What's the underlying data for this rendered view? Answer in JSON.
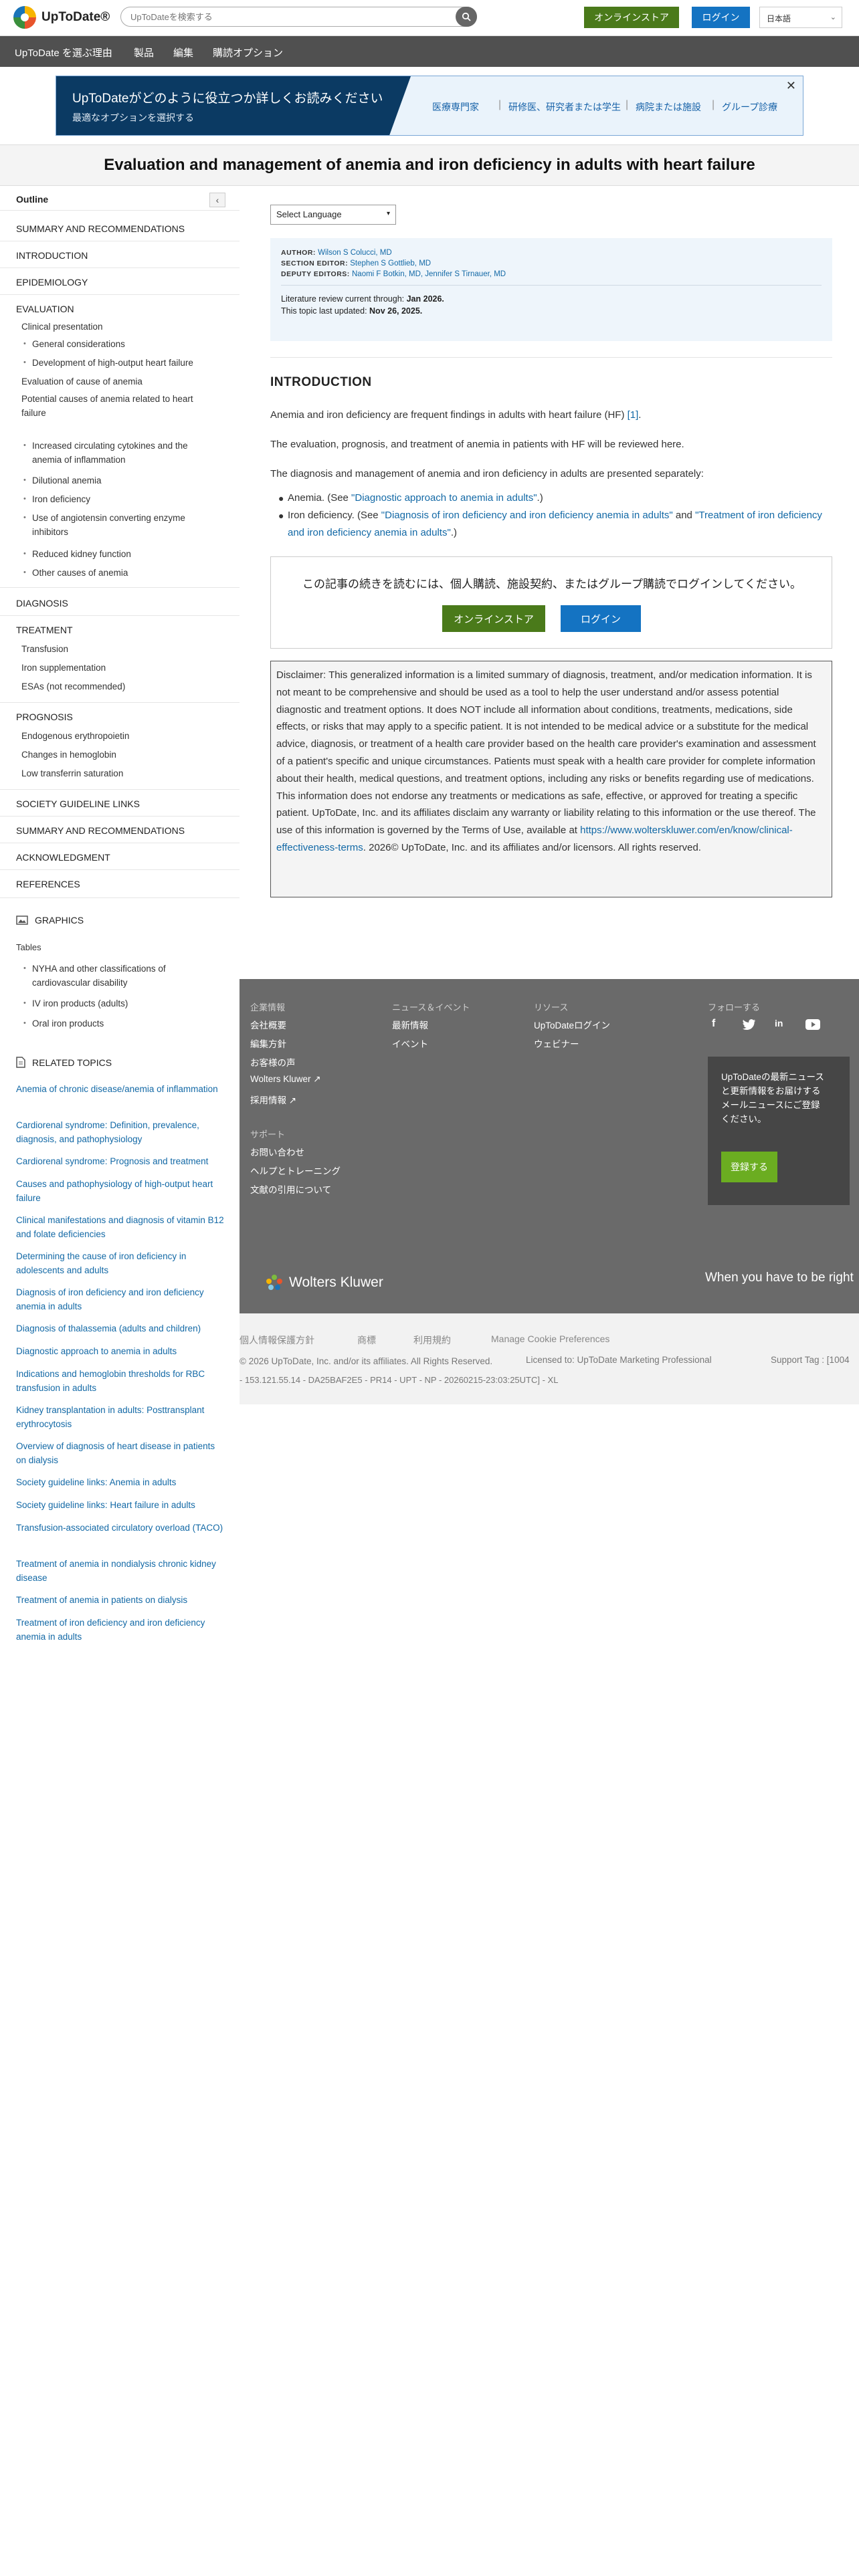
{
  "header": {
    "logo_text": "UpToDate®",
    "search_placeholder": "UpToDateを検索する",
    "store_button": "オンラインストア",
    "login_button": "ログイン",
    "language": "日本語"
  },
  "nav": [
    "UpToDate を選ぶ理由",
    "製品",
    "編集",
    "購読オプション"
  ],
  "banner": {
    "title": "UpToDateがどのように役立つか詳しくお読みください",
    "subtitle": "最適なオプションを選択する",
    "options": [
      "医療専門家",
      "研修医、研究者または学生",
      "病院または施設",
      "グループ診療"
    ]
  },
  "page_title": "Evaluation and management of anemia and iron deficiency in adults with heart failure",
  "outline": {
    "heading": "Outline",
    "items": [
      {
        "text": "SUMMARY AND RECOMMENDATIONS",
        "level": 1
      },
      {
        "text": "INTRODUCTION",
        "level": 1
      },
      {
        "text": "EPIDEMIOLOGY",
        "level": 1
      },
      {
        "text": "EVALUATION",
        "level": 1
      },
      {
        "text": "Clinical presentation",
        "level": 2
      },
      {
        "text": "General considerations",
        "level": 3
      },
      {
        "text": "Development of high-output heart failure",
        "level": 3
      },
      {
        "text": "Evaluation of cause of anemia",
        "level": 2
      },
      {
        "text": "Potential causes of anemia related to heart failure",
        "level": 2
      },
      {
        "text": "Increased circulating cytokines and the anemia of inflammation",
        "level": 3
      },
      {
        "text": "Dilutional anemia",
        "level": 3
      },
      {
        "text": "Iron deficiency",
        "level": 3
      },
      {
        "text": "Use of angiotensin converting enzyme inhibitors",
        "level": 3
      },
      {
        "text": "Reduced kidney function",
        "level": 3
      },
      {
        "text": "Other causes of anemia",
        "level": 3
      },
      {
        "text": "DIAGNOSIS",
        "level": 1
      },
      {
        "text": "TREATMENT",
        "level": 1
      },
      {
        "text": "Transfusion",
        "level": 2
      },
      {
        "text": "Iron supplementation",
        "level": 2
      },
      {
        "text": "ESAs (not recommended)",
        "level": 2
      },
      {
        "text": "PROGNOSIS",
        "level": 1
      },
      {
        "text": "Endogenous erythropoietin",
        "level": 2
      },
      {
        "text": "Changes in hemoglobin",
        "level": 2
      },
      {
        "text": "Low transferrin saturation",
        "level": 2
      },
      {
        "text": "SOCIETY GUIDELINE LINKS",
        "level": 1
      },
      {
        "text": "SUMMARY AND RECOMMENDATIONS",
        "level": 1
      },
      {
        "text": "ACKNOWLEDGMENT",
        "level": 1
      },
      {
        "text": "REFERENCES",
        "level": 1
      }
    ]
  },
  "graphics": {
    "heading": "GRAPHICS",
    "sub": "Tables",
    "items": [
      "NYHA and other classifications of cardiovascular disability",
      "IV iron products (adults)",
      "Oral iron products"
    ]
  },
  "related": {
    "heading": "RELATED TOPICS",
    "items": [
      "Anemia of chronic disease/anemia of inflammation",
      "Cardiorenal syndrome: Definition, prevalence, diagnosis, and pathophysiology",
      "Cardiorenal syndrome: Prognosis and treatment",
      "Causes and pathophysiology of high-output heart failure",
      "Clinical manifestations and diagnosis of vitamin B12 and folate deficiencies",
      "Determining the cause of iron deficiency in adolescents and adults",
      "Diagnosis of iron deficiency and iron deficiency anemia in adults",
      "Diagnosis of thalassemia (adults and children)",
      "Diagnostic approach to anemia in adults",
      "Indications and hemoglobin thresholds for RBC transfusion in adults",
      "Kidney transplantation in adults: Posttransplant erythrocytosis",
      "Overview of diagnosis of heart disease in patients on dialysis",
      "Society guideline links: Anemia in adults",
      "Society guideline links: Heart failure in adults",
      "Transfusion-associated circulatory overload (TACO)",
      "Treatment of anemia in nondialysis chronic kidney disease",
      "Treatment of anemia in patients on dialysis",
      "Treatment of iron deficiency and iron deficiency anemia in adults"
    ]
  },
  "main": {
    "language_select": "Select Language",
    "meta": {
      "author_label": "AUTHOR:",
      "author": "Wilson S Colucci, MD",
      "section_editor_label": "SECTION EDITOR:",
      "section_editor": "Stephen S Gottlieb, MD",
      "deputy_editors_label": "DEPUTY EDITORS:",
      "deputy_editors": "Naomi F Botkin, MD, Jennifer S Tirnauer, MD",
      "lit_review_label": "Literature review current through:",
      "lit_review_date": "Jan 2026.",
      "updated_label": "This topic last updated:",
      "updated_date": "Nov 26, 2025."
    },
    "intro_heading": "INTRODUCTION",
    "p1_text": "Anemia and iron deficiency are frequent findings in adults with heart failure (HF) ",
    "p1_ref": "[1]",
    "p1_end": ".",
    "p2": "The evaluation, prognosis, and treatment of anemia in patients with HF will be reviewed here.",
    "p3": "The diagnosis and management of anemia and iron deficiency in adults are presented separately:",
    "b1_pre": "Anemia. (See ",
    "b1_link": "\"Diagnostic approach to anemia in adults\"",
    "b1_post": ".)",
    "b2_pre": "Iron deficiency. (See ",
    "b2_link1": "\"Diagnosis of iron deficiency and iron deficiency anemia in adults\"",
    "b2_and": " and ",
    "b2_link2": "\"Treatment of iron deficiency and iron deficiency anemia in adults\"",
    "b2_post": ".)",
    "login_prompt": "この記事の続きを読むには、個人購読、施設契約、またはグループ購読でログインしてください。",
    "login_store": "オンラインストア",
    "login_btn": "ログイン",
    "disclaimer_text": "Disclaimer: This generalized information is a limited summary of diagnosis, treatment, and/or medication information. It is not meant to be comprehensive and should be used as a tool to help the user understand and/or assess potential diagnostic and treatment options. It does NOT include all information about conditions, treatments, medications, side effects, or risks that may apply to a specific patient. It is not intended to be medical advice or a substitute for the medical advice, diagnosis, or treatment of a health care provider based on the health care provider's examination and assessment of a patient's specific and unique circumstances. Patients must speak with a health care provider for complete information about their health, medical questions, and treatment options, including any risks or benefits regarding use of medications. This information does not endorse any treatments or medications as safe, effective, or approved for treating a specific patient. UpToDate, Inc. and its affiliates disclaim any warranty or liability relating to this information or the use thereof. The use of this information is governed by the Terms of Use, available at ",
    "disclaimer_link": "https://www.wolterskluwer.com/en/know/clinical-effectiveness-terms",
    "disclaimer_end": ". 2026© UpToDate, Inc. and its affiliates and/or licensors. All rights reserved."
  },
  "footer": {
    "col1_h": "企業情報",
    "col1": [
      "会社概要",
      "編集方針",
      "お客様の声",
      "Wolters Kluwer ↗",
      "採用情報 ↗"
    ],
    "col1b_h": "サポート",
    "col1b": [
      "お問い合わせ",
      "ヘルプとトレーニング",
      "文献の引用について"
    ],
    "col2_h": "ニュース＆イベント",
    "col2": [
      "最新情報",
      "イベント"
    ],
    "col3_h": "リソース",
    "col3": [
      "UpToDateログイン",
      "ウェビナー"
    ],
    "col4_h": "フォローする",
    "social": [
      "f",
      "t",
      "in",
      "yt"
    ],
    "newsletter_text": "UpToDateの最新ニュースと更新情報をお届けするメールニュースにご登録ください。",
    "newsletter_button": "登録する",
    "brand": "Wolters Kluwer",
    "tagline": "When you have to be right"
  },
  "subfooter": {
    "links": [
      "個人情報保護方針",
      "商標",
      "利用規約",
      "Manage Cookie Preferences"
    ],
    "copyright": "© 2026 UpToDate, Inc. and/or its affiliates. All Rights Reserved.",
    "licensed": "Licensed to: UpToDate Marketing Professional",
    "support_tag": "Support Tag : [1004",
    "ip_line": "- 153.121.55.14 - DA25BAF2E5 - PR14 - UPT - NP - 20260215-23:03:25UTC] - XL"
  },
  "colors": {
    "accent_blue": "#1473c2",
    "store_green": "#4a7a1a",
    "nav_gray": "#505050",
    "link": "#1369a6",
    "footer_gray": "#6a6a6a",
    "newsletter_green": "#6bad21"
  }
}
